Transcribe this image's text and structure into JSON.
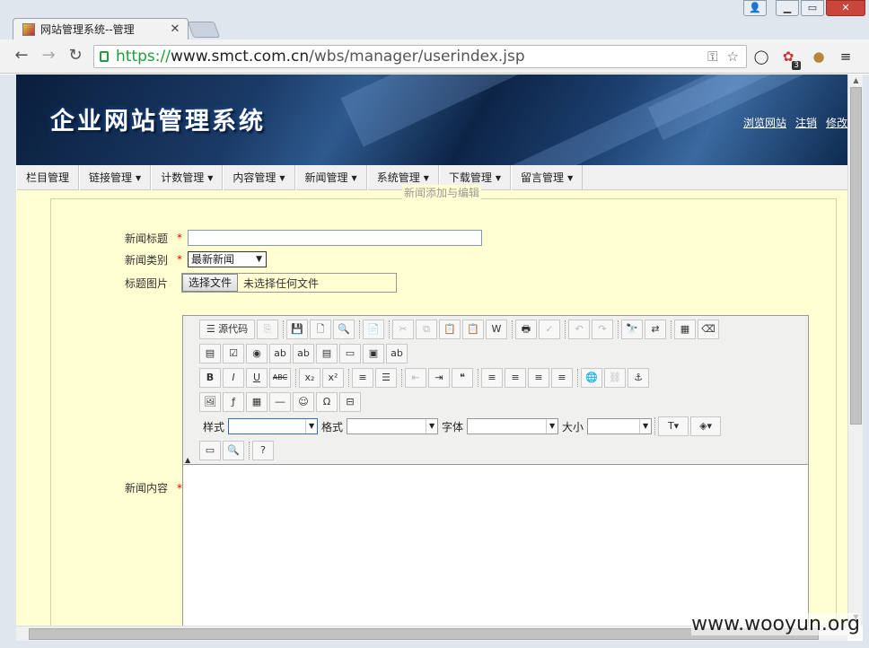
{
  "browser": {
    "tab_title": "网站管理系统--管理",
    "url_scheme": "https://",
    "url_host": "www.smct.com.cn",
    "url_path": "/wbs/manager/userindex.jsp",
    "extension_badge": "3"
  },
  "site": {
    "title": "企业网站管理系统",
    "top_links": [
      "浏览网站",
      "注销",
      "修改"
    ]
  },
  "menu": [
    {
      "label": "栏目管理",
      "has_caret": false
    },
    {
      "label": "链接管理",
      "has_caret": true
    },
    {
      "label": "计数管理",
      "has_caret": true
    },
    {
      "label": "内容管理",
      "has_caret": true
    },
    {
      "label": "新闻管理",
      "has_caret": true
    },
    {
      "label": "系统管理",
      "has_caret": true
    },
    {
      "label": "下载管理",
      "has_caret": true
    },
    {
      "label": "留言管理",
      "has_caret": true
    }
  ],
  "form": {
    "legend": "新闻添加与编辑",
    "title_label": "新闻标题",
    "title_value": "",
    "category_label": "新闻类别",
    "category_selected": "最新新闻",
    "image_label": "标题图片",
    "file_button": "选择文件",
    "file_status": "未选择任何文件",
    "content_label": "新闻内容",
    "required_mark": "*"
  },
  "editor": {
    "source_button": "源代码",
    "style_label": "样式",
    "format_label": "格式",
    "font_label": "字体",
    "size_label": "大小"
  },
  "watermark": "www.wooyun.org"
}
